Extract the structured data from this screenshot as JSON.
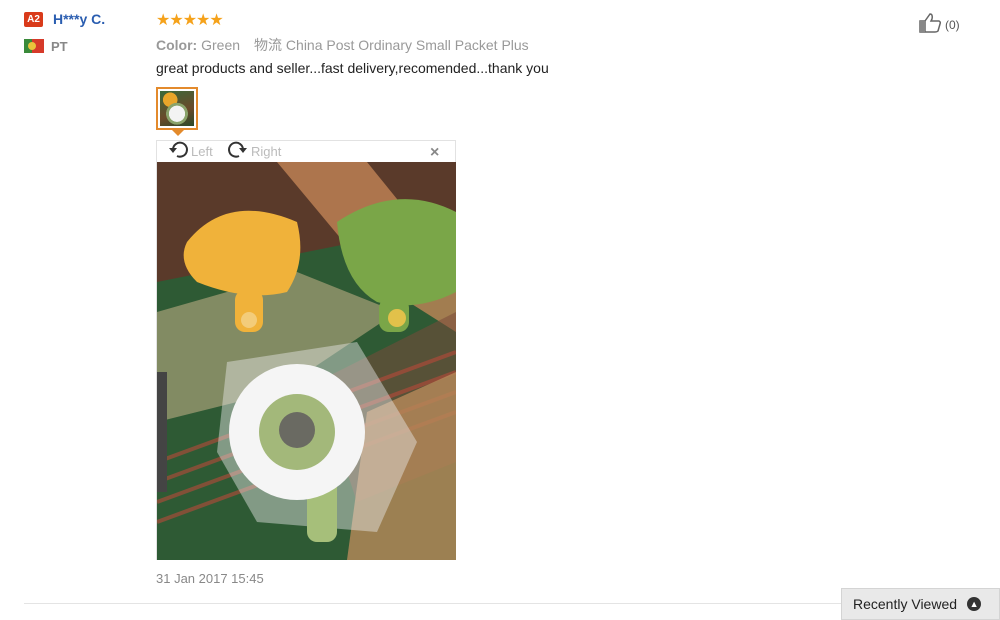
{
  "reviewer": {
    "level_badge": "A2",
    "name": "H***y C.",
    "country_code": "PT"
  },
  "review": {
    "rating_stars": 5,
    "stars_glyphs": "★★★★★",
    "color_label": "Color:",
    "color_value": "Green",
    "shipping": "物流 China Post Ordinary Small Packet Plus",
    "text": "great products and seller...fast delivery,recomended...thank you",
    "date": "31 Jan 2017 15:45"
  },
  "viewer": {
    "rotate_left_label": "Left",
    "rotate_right_label": "Right",
    "close_glyph": "×"
  },
  "helpful": {
    "count": "(0)"
  },
  "recently_viewed": {
    "label": "Recently Viewed"
  },
  "colors": {
    "star": "#f5a21b",
    "username": "#2a5db0",
    "badge": "#d93a1a",
    "thumb_border": "#e38a2c"
  }
}
